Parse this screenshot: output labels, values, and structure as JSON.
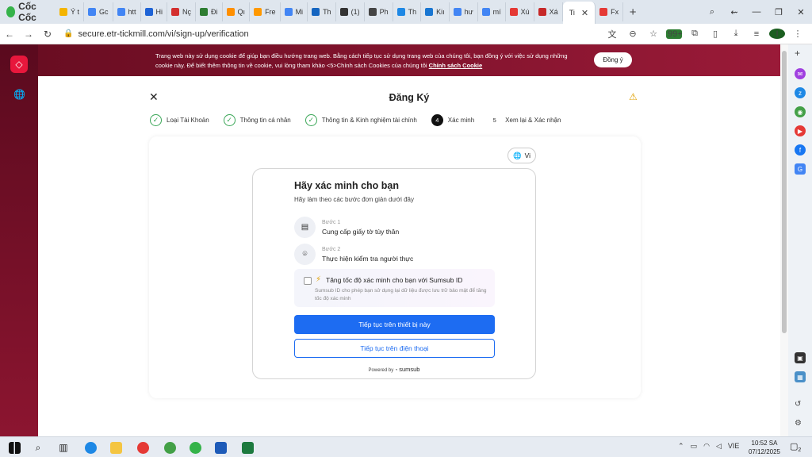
{
  "browser": {
    "brand": "Cốc Cốc",
    "tabs": [
      {
        "label": "Ý t",
        "color": "#f4b400"
      },
      {
        "label": "Gc",
        "color": "#4285f4"
      },
      {
        "label": "htt",
        "color": "#4285f4"
      },
      {
        "label": "Hi",
        "color": "#1e63d6"
      },
      {
        "label": "Nç",
        "color": "#d32f2f"
      },
      {
        "label": "Đi",
        "color": "#2e7d32"
      },
      {
        "label": "Qı",
        "color": "#ff8f00"
      },
      {
        "label": "Fre",
        "color": "#ff9800"
      },
      {
        "label": "Mi",
        "color": "#4285f4"
      },
      {
        "label": "Th",
        "color": "#1565c0"
      },
      {
        "label": "(1)",
        "color": "#333333"
      },
      {
        "label": "Ph",
        "color": "#444444"
      },
      {
        "label": "Th",
        "color": "#1e88e5"
      },
      {
        "label": "Kiı",
        "color": "#1976d2"
      },
      {
        "label": "hư",
        "color": "#4285f4"
      },
      {
        "label": "mí",
        "color": "#4285f4"
      },
      {
        "label": "Xú",
        "color": "#e53935"
      },
      {
        "label": "Xá",
        "color": "#c62828"
      }
    ],
    "active_tab": "Ti",
    "after_tab": "Fx",
    "url": "secure.etr-tickmill.com/vi/sign-up/verification",
    "badge": "99+",
    "profile_initial": "I"
  },
  "cookie_banner": {
    "message": "Trang web này sử dụng cookie để giúp bạn điều hướng trang web. Bằng cách tiếp tục sử dụng trang web của chúng tôi, bạn đồng ý với việc sử dụng những cookie này. Để biết thêm thông tin về cookie, vui lòng tham khảo <5>Chính sách Cookies của chúng tôi",
    "link": "Chính sách Cookie",
    "agree_label": "Đồng ý"
  },
  "page": {
    "title": "Đăng Ký",
    "steps": [
      {
        "label": "Loại Tài Khoản",
        "status": "done"
      },
      {
        "label": "Thông tin cá nhân",
        "status": "done"
      },
      {
        "label": "Thông tin & Kinh nghiệm tài chính",
        "status": "done"
      },
      {
        "num": "4",
        "label": "Xác minh",
        "status": "current"
      },
      {
        "num": "5",
        "label": "Xem lại & Xác nhận",
        "status": "pending"
      }
    ],
    "lang_label": "Vi"
  },
  "verify": {
    "heading": "Hãy xác minh cho bạn",
    "subheading": "Hãy làm theo các bước đơn giản dưới đây",
    "step1_label": "Bước 1",
    "step1_text": "Cung cấp giấy tờ tùy thân",
    "step2_label": "Bước 2",
    "step2_text": "Thực hiện kiểm tra người thực",
    "sumsub_head": "Tăng tốc độ xác minh cho bạn với Sumsub ID",
    "sumsub_desc": "Sumsub ID cho phép bạn sử dụng lại dữ liệu được lưu trữ bảo mật để tăng tốc độ xác minh",
    "btn_device": "Tiếp tục trên thiết bị này",
    "btn_phone": "Tiếp tục trên điện thoại",
    "powered_by": "Powered by",
    "powered_brand": "sumsub"
  },
  "taskbar": {
    "lang": "VIE",
    "time": "10:52 SA",
    "date": "07/12/2025",
    "notif_count": "2"
  }
}
